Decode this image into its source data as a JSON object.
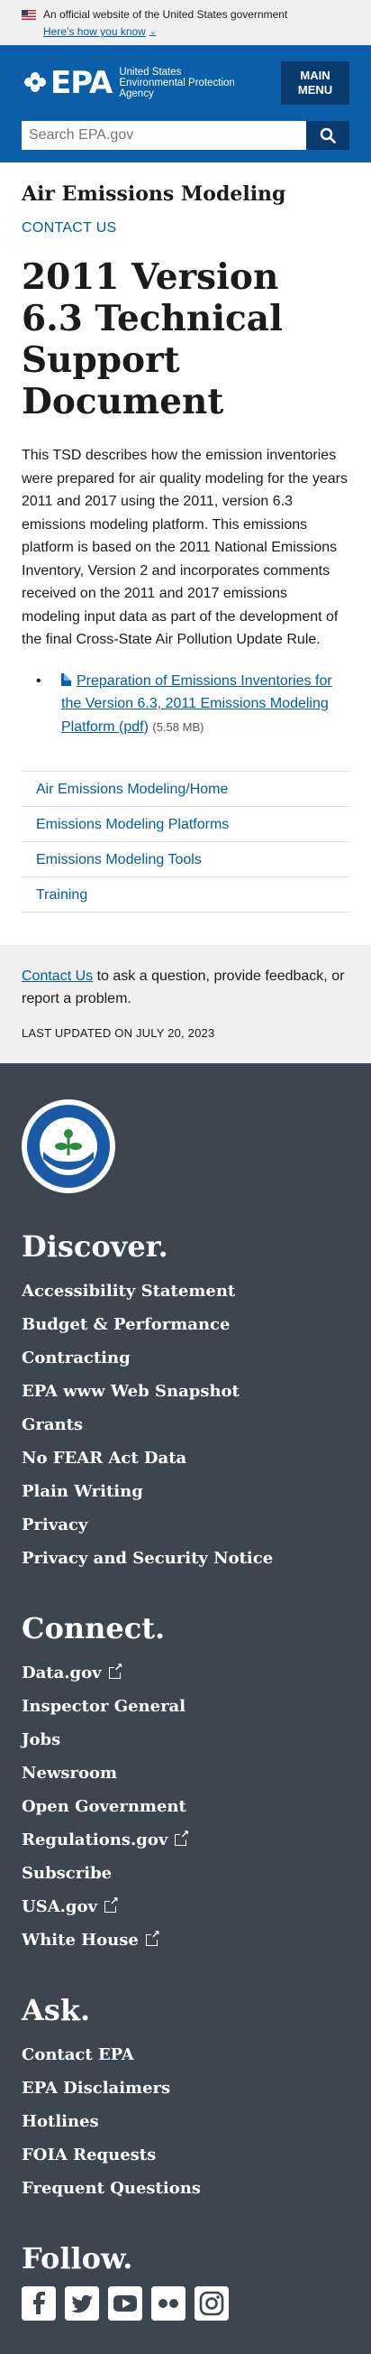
{
  "gov_banner": {
    "official_text": "An official website of the United States government",
    "how_link": "Here’s how you know"
  },
  "header": {
    "logo_letters": "EPA",
    "logo_text_line1": "United States",
    "logo_text_line2": "Environmental Protection",
    "logo_text_line3": "Agency",
    "menu_line1": "MAIN",
    "menu_line2": "MENU",
    "search_placeholder": "Search EPA.gov"
  },
  "main": {
    "section_title": "Air Emissions Modeling",
    "contact_us": "CONTACT US",
    "page_title": "2011 Version 6.3 Technical Support Document",
    "intro": "This TSD describes how the emission inventories were prepared for air quality modeling for the years 2011 and 2017 using the 2011, version 6.3 emissions modeling platform. This emissions platform is based on the 2011 National Emissions Inventory, Version 2 and incorporates comments received on the 2011 and 2017 emissions modeling input data as part of the development of the final Cross-State Air Pollution Update Rule.",
    "document": {
      "link": "Preparation of Emissions Inventories for the Version 6.3, 2011 Emissions Modeling Platform (pdf)",
      "size": "(5.58 MB)"
    },
    "side_nav": [
      {
        "label": "Air Emissions Modeling/Home"
      },
      {
        "label": "Emissions Modeling Platforms"
      },
      {
        "label": "Emissions Modeling Tools"
      },
      {
        "label": "Training"
      }
    ]
  },
  "contact_box": {
    "link": "Contact Us",
    "text": " to ask a question, provide feedback, or report a problem.",
    "updated": "LAST UPDATED ON JULY 20, 2023"
  },
  "footer": {
    "seal_text": "UNITED STATES ENVIRONMENTAL PROTECTION",
    "discover": {
      "title": "Discover.",
      "items": [
        "Accessibility Statement",
        "Budget & Performance",
        "Contracting",
        "EPA www Web Snapshot",
        "Grants",
        "No FEAR Act Data",
        "Plain Writing",
        "Privacy",
        "Privacy and Security Notice"
      ]
    },
    "connect": {
      "title": "Connect.",
      "items": [
        "Data.gov",
        "Inspector General",
        "Jobs",
        "Newsroom",
        "Open Government",
        "Regulations.gov",
        "Subscribe",
        "USA.gov",
        "White House"
      ]
    },
    "ask": {
      "title": "Ask.",
      "items": [
        "Contact EPA",
        "EPA Disclaimers",
        "Hotlines",
        "FOIA Requests",
        "Frequent Questions"
      ]
    },
    "follow": {
      "title": "Follow.",
      "icons": [
        "facebook-icon",
        "twitter-icon",
        "youtube-icon",
        "flickr-icon",
        "instagram-icon"
      ]
    }
  }
}
